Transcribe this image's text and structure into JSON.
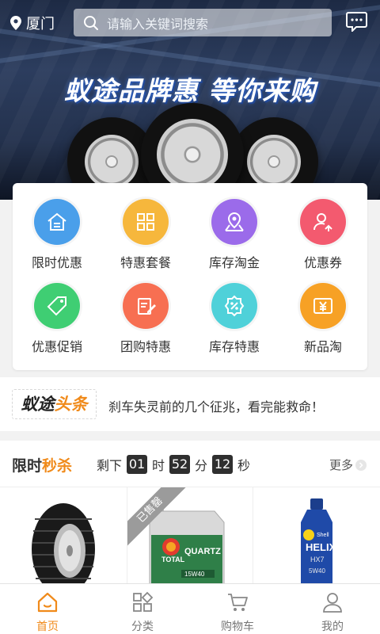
{
  "topbar": {
    "city": "厦门",
    "search_placeholder": "请输入关键词搜索"
  },
  "banner": {
    "slogan": "蚁途品牌惠 等你来购"
  },
  "categories": [
    {
      "label": "限时优惠",
      "icon": "home-icon",
      "color": "#4a9fea"
    },
    {
      "label": "特惠套餐",
      "icon": "grid-icon",
      "color": "#f6b73c"
    },
    {
      "label": "库存淘金",
      "icon": "map-pin-icon",
      "color": "#9b6bea"
    },
    {
      "label": "优惠券",
      "icon": "user-icon",
      "color": "#f35a6f"
    },
    {
      "label": "优惠促销",
      "icon": "tag-icon",
      "color": "#3fce73"
    },
    {
      "label": "团购特惠",
      "icon": "edit-icon",
      "color": "#f76f52"
    },
    {
      "label": "库存特惠",
      "icon": "percent-icon",
      "color": "#4fd1d9"
    },
    {
      "label": "新品淘",
      "icon": "yen-ticket-icon",
      "color": "#f7a125"
    }
  ],
  "headline": {
    "logo_part1": "蚁途",
    "logo_part2": "头条",
    "text": "刹车失灵前的几个征兆，看完能救命！"
  },
  "flash_sale": {
    "title_part1": "限时",
    "title_part2": "秒杀",
    "countdown_prefix": "剩下",
    "hours": "01",
    "hours_unit": "时",
    "minutes": "52",
    "minutes_unit": "分",
    "seconds": "12",
    "seconds_unit": "秒",
    "more": "更多",
    "products": [
      {
        "name": "tire",
        "sold_out": false
      },
      {
        "name": "TOTAL QUARTZ 5000 15W40",
        "sold_out": true,
        "sold_label": "已售罄",
        "brand": "TOTAL",
        "line": "QUARTZ",
        "grade": "15W40"
      },
      {
        "name": "Shell HELIX HX7 5W40",
        "sold_out": false,
        "brand": "Shell",
        "line": "HELIX",
        "grade": "HX7",
        "viscosity": "5W40"
      }
    ]
  },
  "nav": [
    {
      "label": "首页",
      "icon": "home-icon",
      "active": true
    },
    {
      "label": "分类",
      "icon": "category-icon",
      "active": false
    },
    {
      "label": "购物车",
      "icon": "cart-icon",
      "active": false
    },
    {
      "label": "我的",
      "icon": "profile-icon",
      "active": false
    }
  ],
  "colors": {
    "accent": "#f08a1a",
    "countdown_box": "#2f2f2f"
  }
}
